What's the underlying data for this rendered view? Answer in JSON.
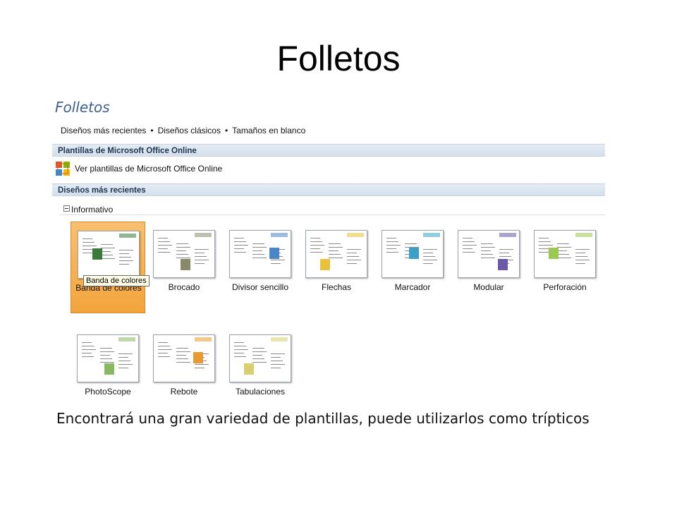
{
  "slide": {
    "title": "Folletos",
    "caption": "Encontrará una gran variedad de plantillas, puede utilizarlos como trípticos"
  },
  "panel": {
    "heading": "Folletos",
    "links": [
      "Diseños más recientes",
      "Diseños clásicos",
      "Tamaños en blanco"
    ],
    "link_separator": "•",
    "online_section": {
      "title": "Plantillas de Microsoft Office Online",
      "link": "Ver plantillas de Microsoft Office Online",
      "icon": "office-online-icon"
    },
    "recent_section": {
      "title": "Diseños más recientes",
      "group": "Informativo",
      "group_state": "expanded"
    },
    "templates": [
      {
        "label": "Banda de colores",
        "selected": true,
        "accent": "#3b7a3b"
      },
      {
        "label": "Brocado",
        "selected": false,
        "accent": "#8a8a6a"
      },
      {
        "label": "Divisor sencillo",
        "selected": false,
        "accent": "#4a86c8"
      },
      {
        "label": "Flechas",
        "selected": false,
        "accent": "#e8c23a"
      },
      {
        "label": "Marcador",
        "selected": false,
        "accent": "#3aa0c8"
      },
      {
        "label": "Modular",
        "selected": false,
        "accent": "#6a5aa8"
      },
      {
        "label": "Perforación",
        "selected": false,
        "accent": "#9ac850"
      },
      {
        "label": "PhotoScope",
        "selected": false,
        "accent": "#8ab860"
      },
      {
        "label": "Rebote",
        "selected": false,
        "accent": "#e89a30"
      },
      {
        "label": "Tabulaciones",
        "selected": false,
        "accent": "#d8d070"
      }
    ],
    "tooltip": "Banda de colores"
  },
  "colors": {
    "selected_tile": "#f3a43c",
    "section_bar": "#dbe5f0",
    "heading_text": "#3f5f8f"
  }
}
